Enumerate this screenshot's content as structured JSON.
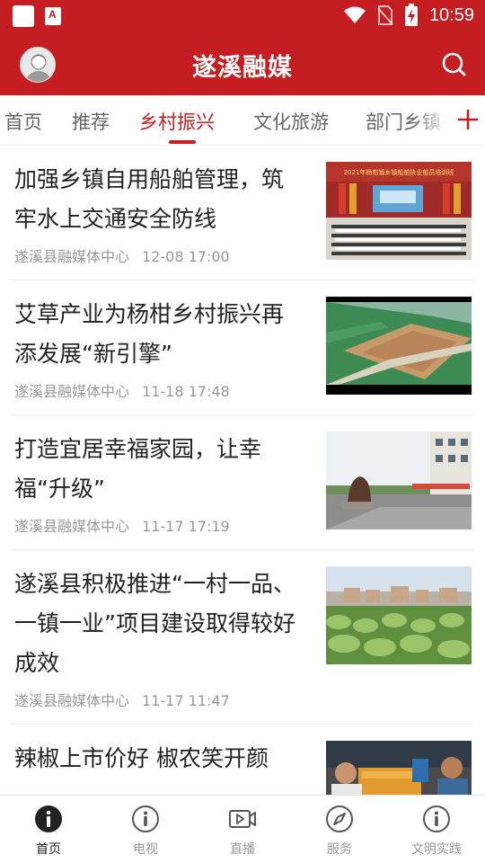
{
  "status_bar": {
    "time": "10:59"
  },
  "header": {
    "title": "遂溪融媒"
  },
  "tabs": [
    {
      "label": "首页",
      "active": false
    },
    {
      "label": "推荐",
      "active": false
    },
    {
      "label": "乡村振兴",
      "active": true
    },
    {
      "label": "文化旅游",
      "active": false
    },
    {
      "label": "部门乡镇",
      "active": false
    }
  ],
  "articles": [
    {
      "title": "加强乡镇自用船舶管理，筑牢水上交通安全防线",
      "source": "遂溪县融媒体中心",
      "time": "12-08 17:00",
      "thumb_banner": "2021年杨柑镇乡镇船舶执业船员培训班"
    },
    {
      "title": "艾草产业为杨柑乡村振兴再添发展“新引擎”",
      "source": "遂溪县融媒体中心",
      "time": "11-18 17:48"
    },
    {
      "title": "打造宜居幸福家园，让幸福“升级”",
      "source": "遂溪县融媒体中心",
      "time": "11-17 17:19"
    },
    {
      "title": "遂溪县积极推进“一村一品、一镇一业”项目建设取得较好成效",
      "source": "遂溪县融媒体中心",
      "time": "11-17 11:47"
    },
    {
      "title": "辣椒上市价好 椒农笑开颜",
      "source": "",
      "time": ""
    }
  ],
  "bottom_nav": [
    {
      "label": "首页",
      "icon": "info-icon",
      "active": true
    },
    {
      "label": "电视",
      "icon": "info-icon",
      "active": false
    },
    {
      "label": "直播",
      "icon": "video-icon",
      "active": false
    },
    {
      "label": "服务",
      "icon": "compass-icon",
      "active": false
    },
    {
      "label": "文明实践",
      "icon": "info-icon",
      "active": false
    }
  ],
  "colors": {
    "brand": "#c41d22",
    "text": "#222222",
    "muted": "#999999"
  }
}
